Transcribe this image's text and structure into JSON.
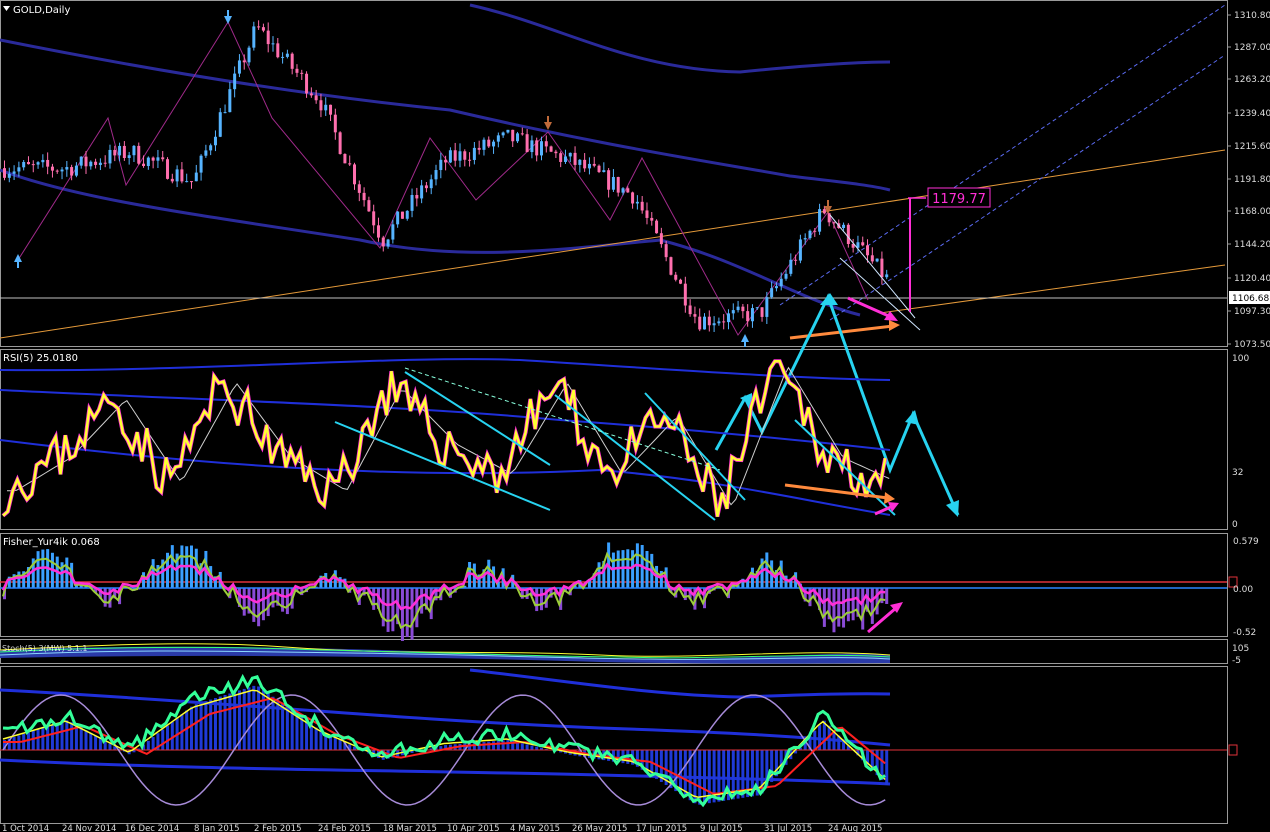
{
  "header": {
    "symbol_label": "GOLD,Daily"
  },
  "colors": {
    "background": "#000000",
    "panel_border": "#9a9a9a",
    "bull_candle": "#56b4ff",
    "bear_candle": "#ff6fae",
    "ma_line": "#2a2a9a",
    "trend_orange": "#e59a3a",
    "channel_dashed": "#4a5ad8",
    "cyan_arrow": "#27d3f0",
    "magenta": "#ff2fd6",
    "orange_arrow": "#ff8a3d",
    "rsi_yellow": "#ffff33",
    "rsi_band": "#1f2fd9",
    "fisher_hist": "#8a4bd6",
    "fisher_zero": "#2a86ff",
    "fisher_level": "#e0323a"
  },
  "icons": [
    "dropdown-arrow-icon",
    "up-arrow-icon",
    "down-arrow-icon"
  ],
  "chart_data": [
    {
      "name": "price",
      "type": "line",
      "title": "GOLD,Daily",
      "x": [
        "1 Oct 2014",
        "24 Nov 2014",
        "16 Dec 2014",
        "8 Jan 2015",
        "2 Feb 2015",
        "24 Feb 2015",
        "18 Mar 2015",
        "10 Apr 2015",
        "4 May 2015",
        "26 May 2015",
        "17 Jun 2015",
        "9 Jul 2015",
        "31 Jul 2015",
        "24 Aug 2015"
      ],
      "series": [
        {
          "values": [
            1200,
            1200,
            1212,
            1190,
            1302,
            1250,
            1148,
            1205,
            1222,
            1205,
            1180,
            1090,
            1095,
            1170,
            1120
          ]
        }
      ],
      "yticks": [
        "1310.80",
        "1287.00",
        "1263.20",
        "1239.40",
        "1215.60",
        "1191.80",
        "1168.00",
        "1144.20",
        "1120.40",
        "1106.68",
        "1097.30",
        "1073.50"
      ],
      "current_price": "1106.68",
      "target_price_label": "1179.77",
      "ylim": [
        1068,
        1315
      ]
    },
    {
      "name": "rsi",
      "type": "line",
      "title": "RSI(5) 25.0180",
      "yticks": [
        "100",
        "32",
        "0"
      ],
      "ylim": [
        0,
        100
      ],
      "series": [
        {
          "values": [
            20,
            40,
            75,
            25,
            85,
            40,
            20,
            82,
            48,
            30,
            85,
            30,
            65,
            10,
            95,
            40,
            25
          ]
        }
      ]
    },
    {
      "name": "fisher",
      "type": "bar",
      "title": "Fisher_Yur4ik 0.068",
      "yticks": [
        "0.579",
        "0.00",
        "-0.52"
      ],
      "ylim": [
        -0.6,
        0.6
      ]
    },
    {
      "name": "stochastic",
      "type": "line",
      "title": "Stoch(5) 3(MW) 5.1.1",
      "yticks": [
        "105",
        "-5"
      ]
    },
    {
      "name": "oscillator",
      "type": "area",
      "title": "",
      "yticks": []
    }
  ]
}
